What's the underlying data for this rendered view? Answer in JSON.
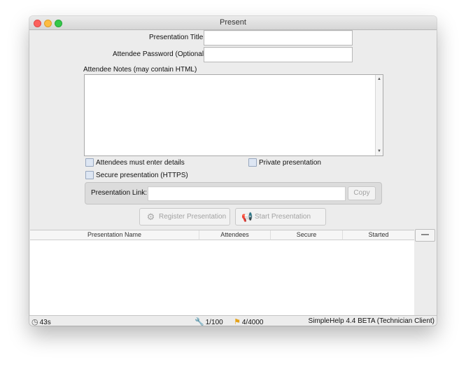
{
  "window": {
    "title": "Present"
  },
  "form": {
    "title_label": "Presentation Title",
    "title_value": "",
    "password_label": "Attendee Password (Optional)",
    "password_value": "",
    "notes_label": "Attendee Notes (may contain HTML)",
    "notes_value": ""
  },
  "options": {
    "attendees_details": {
      "label": "Attendees must enter details",
      "checked": false
    },
    "private": {
      "label": "Private presentation",
      "checked": false
    },
    "secure": {
      "label": "Secure presentation (HTTPS)",
      "checked": false
    }
  },
  "link": {
    "label": "Presentation Link:",
    "value": "",
    "copy_label": "Copy"
  },
  "actions": {
    "register_label": "Register Presentation",
    "start_label": "Start Presentation"
  },
  "table": {
    "columns": [
      "Presentation Name",
      "Attendees",
      "Secure",
      "Started"
    ],
    "rows": [],
    "remove_label": "—"
  },
  "status": {
    "timer": "43s",
    "sessions": "1/100",
    "credits": "4/4000",
    "version": "SimpleHelp 4.4 BETA (Technician Client)"
  },
  "colors": {
    "close": "#fc605c",
    "minimize": "#fdbc40",
    "maximize": "#34c84a",
    "checkbox_fill": "#dde6f3"
  }
}
